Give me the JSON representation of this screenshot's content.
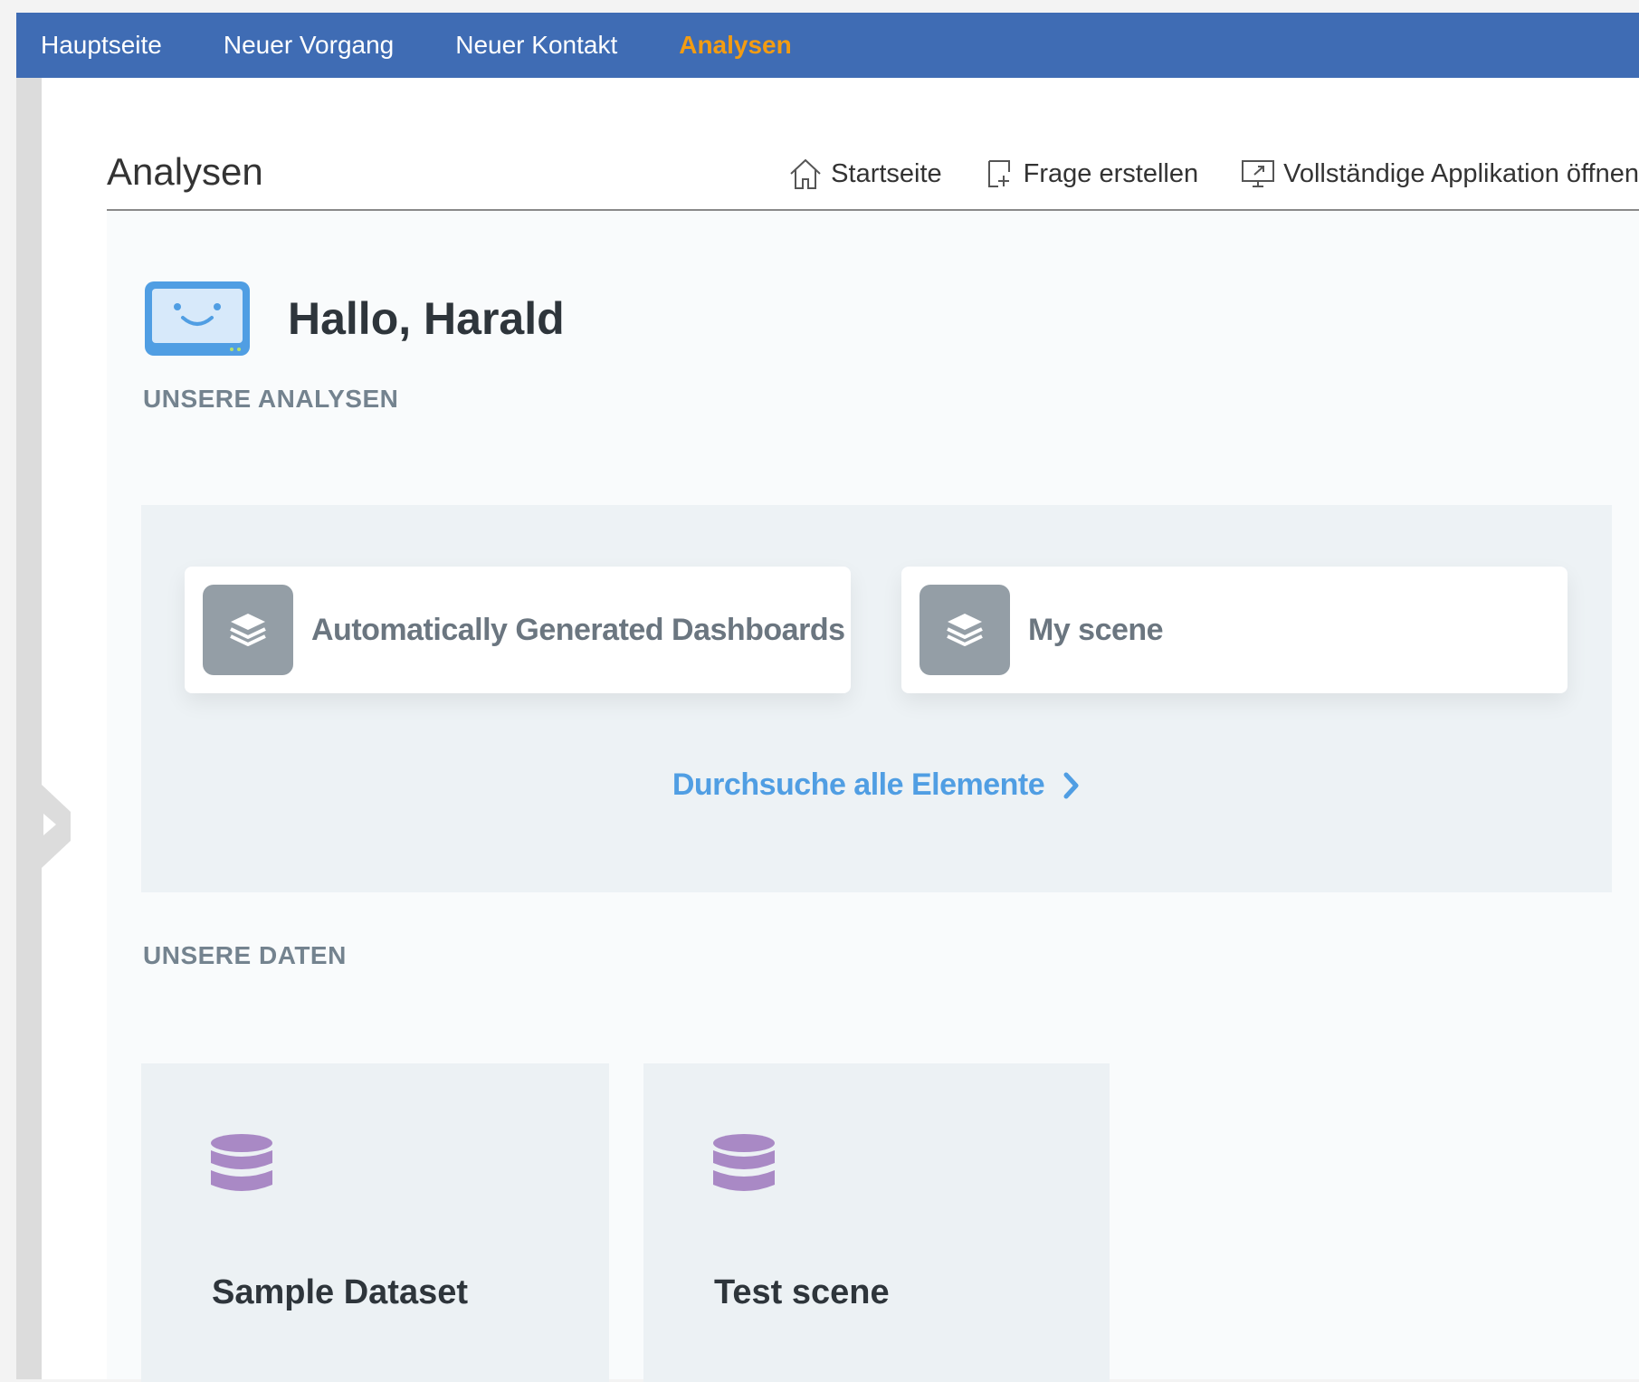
{
  "topnav": {
    "items": [
      {
        "label": "Hauptseite",
        "active": false
      },
      {
        "label": "Neuer Vorgang",
        "active": false
      },
      {
        "label": "Neuer Kontakt",
        "active": false
      },
      {
        "label": "Analysen",
        "active": true
      }
    ],
    "background": "#3f6cb4",
    "active_color": "#f39c12"
  },
  "header": {
    "title": "Analysen",
    "actions": {
      "home": {
        "label": "Startseite",
        "icon": "home-icon"
      },
      "new_question": {
        "label": "Frage erstellen",
        "icon": "add-document-icon"
      },
      "open_app": {
        "label": "Vollständige Applikation öffnen",
        "icon": "open-external-monitor-icon"
      }
    }
  },
  "greeting": {
    "text": "Hallo, Harald",
    "icon": "smiley-monitor-icon"
  },
  "analyses": {
    "section_label": "UNSERE ANALYSEN",
    "collections": [
      {
        "label": "Automatically Generated Dashboards",
        "icon": "stack-layers-icon"
      },
      {
        "label": "My scene",
        "icon": "stack-layers-icon"
      }
    ],
    "browse_label": "Durchsuche alle Elemente"
  },
  "data": {
    "section_label": "UNSERE DATEN",
    "databases": [
      {
        "label": "Sample Dataset",
        "icon": "database-icon"
      },
      {
        "label": "Test scene",
        "icon": "database-icon"
      }
    ],
    "icon_color": "#a989c5"
  },
  "colors": {
    "link": "#509ee3",
    "card_icon_bg": "#949ea6"
  }
}
